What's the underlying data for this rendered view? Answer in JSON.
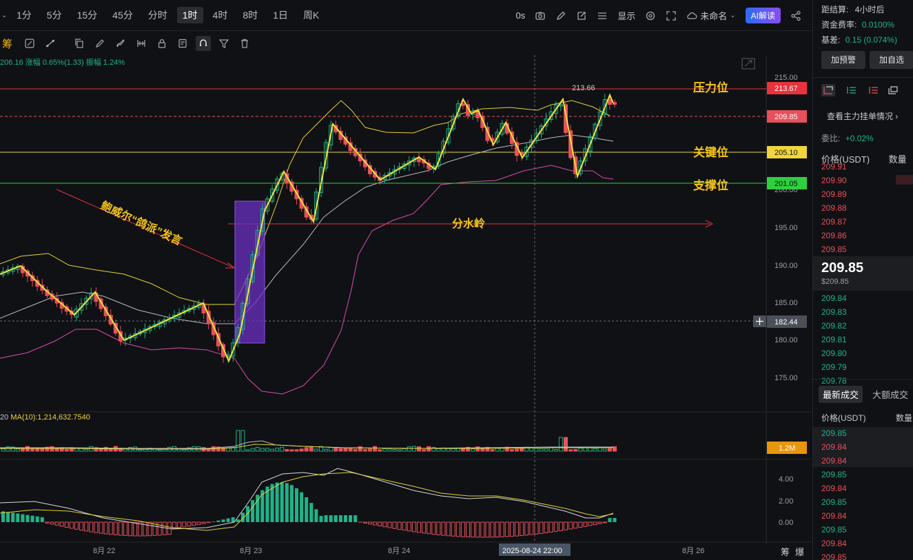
{
  "toolbar": {
    "timeframes": [
      "1分",
      "5分",
      "15分",
      "45分",
      "分时",
      "1时",
      "4时",
      "8时",
      "1日",
      "周K"
    ],
    "active_timeframe": "1时",
    "countdown": "0s",
    "display_label": "显示",
    "layout_name": "未命名",
    "ai_label": "AI解读"
  },
  "draw_tools": {
    "chou_label": "筹"
  },
  "chart_info": {
    "price_info": "206.16 涨幅 0.65%(1.33) 振幅 1.24%",
    "ma_prefix": "20",
    "ma_text": "MA(10):1,214,632.7540"
  },
  "price_axis": {
    "ticks": [
      "215.00",
      "200.00",
      "195.00",
      "190.00",
      "185.00",
      "180.00",
      "175.00"
    ],
    "tags": [
      {
        "label": "213.67",
        "color": "#e8323e",
        "text_color": "#ffffff"
      },
      {
        "label": "209.85",
        "color": "#e8505b",
        "text_color": "#ffffff"
      },
      {
        "label": "205.10",
        "color": "#f0d63c",
        "text_color": "#101114"
      },
      {
        "label": "201.05",
        "color": "#2fcf3e",
        "text_color": "#101114"
      },
      {
        "label": "182.44",
        "color": "#4a4f58",
        "text_color": "#ffffff"
      }
    ],
    "volume_tag": "1.2M",
    "macd_ticks": [
      "4.00",
      "2.00",
      "0.00"
    ]
  },
  "annotations": {
    "resistance": "压力位",
    "key_level": "关键位",
    "support": "支撑位",
    "watershed": "分水岭",
    "powell": "鲍威尔“鸽派”发言",
    "high_label": "213.66"
  },
  "time_axis": {
    "labels": [
      "8月 22",
      "8月 23",
      "8月 24",
      "8月 26"
    ],
    "crosshair_time": "2025-08-24 22:00",
    "corner_labels": [
      "筹",
      "爆"
    ]
  },
  "right_panel": {
    "settlement_label": "距结算:",
    "settlement_value": "4小时后",
    "funding_label": "资金费率:",
    "funding_value": "0.0100%",
    "basis_label": "基差:",
    "basis_value": "0.15 (0.074%)",
    "alert_button": "加预警",
    "watch_button": "加自选",
    "depth_link": "查看主力挂单情况",
    "ratio_label": "委比:",
    "ratio_value": "+0.02%",
    "price_header": "价格(USDT)",
    "qty_header": "数量",
    "asks": [
      "209.91",
      "209.90",
      "209.89",
      "209.88",
      "209.87",
      "209.86",
      "209.85"
    ],
    "last_price": "209.85",
    "last_price_usd": "$209.85",
    "bids": [
      "209.84",
      "209.83",
      "209.82",
      "209.81",
      "209.80",
      "209.79",
      "209.78"
    ],
    "trade_tabs": [
      "最新成交",
      "大额成交"
    ],
    "trades_price_header": "价格(USDT)",
    "trades_qty_header": "数量",
    "trades": [
      {
        "price": "209.85",
        "side": "buy"
      },
      {
        "price": "209.84",
        "side": "sell"
      },
      {
        "price": "209.84",
        "side": "sell"
      },
      {
        "price": "209.85",
        "side": "buy"
      },
      {
        "price": "209.84",
        "side": "sell"
      },
      {
        "price": "209.85",
        "side": "buy"
      },
      {
        "price": "209.84",
        "side": "sell"
      },
      {
        "price": "209.85",
        "side": "buy"
      },
      {
        "price": "209.84",
        "side": "sell"
      },
      {
        "price": "209.85",
        "side": "sell"
      }
    ]
  }
}
